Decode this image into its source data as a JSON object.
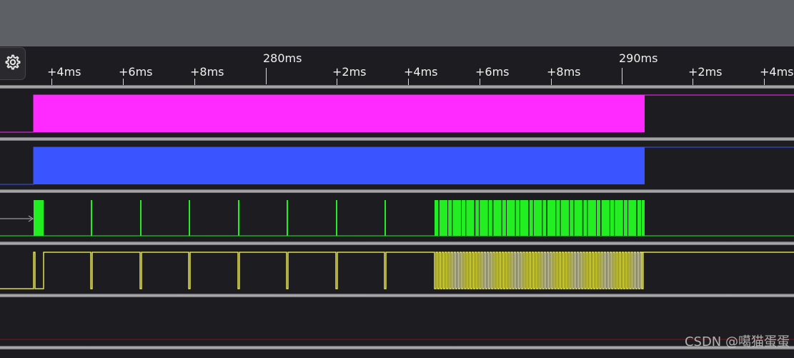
{
  "ruler": {
    "ticks": [
      {
        "label": "+4ms",
        "kind": "minor"
      },
      {
        "label": "+6ms",
        "kind": "minor"
      },
      {
        "label": "+8ms",
        "kind": "minor"
      },
      {
        "label": "280ms",
        "kind": "major"
      },
      {
        "label": "+2ms",
        "kind": "minor"
      },
      {
        "label": "+4ms",
        "kind": "minor"
      },
      {
        "label": "+6ms",
        "kind": "minor"
      },
      {
        "label": "+8ms",
        "kind": "minor"
      },
      {
        "label": "290ms",
        "kind": "major"
      },
      {
        "label": "+2ms",
        "kind": "minor"
      },
      {
        "label": "+4ms",
        "kind": "minor"
      }
    ]
  },
  "settings": {
    "icon": "gear-icon"
  },
  "channels": [
    {
      "name": "magenta-channel",
      "color": "#ff2aff"
    },
    {
      "name": "blue-channel",
      "color": "#3a55ff"
    },
    {
      "name": "green-channel",
      "color": "#22ee22"
    },
    {
      "name": "yellow-channel",
      "color": "#ffff55"
    },
    {
      "name": "empty-channel",
      "color": "#a01818"
    }
  ],
  "watermark": "CSDN @噶猫蛋蛋"
}
